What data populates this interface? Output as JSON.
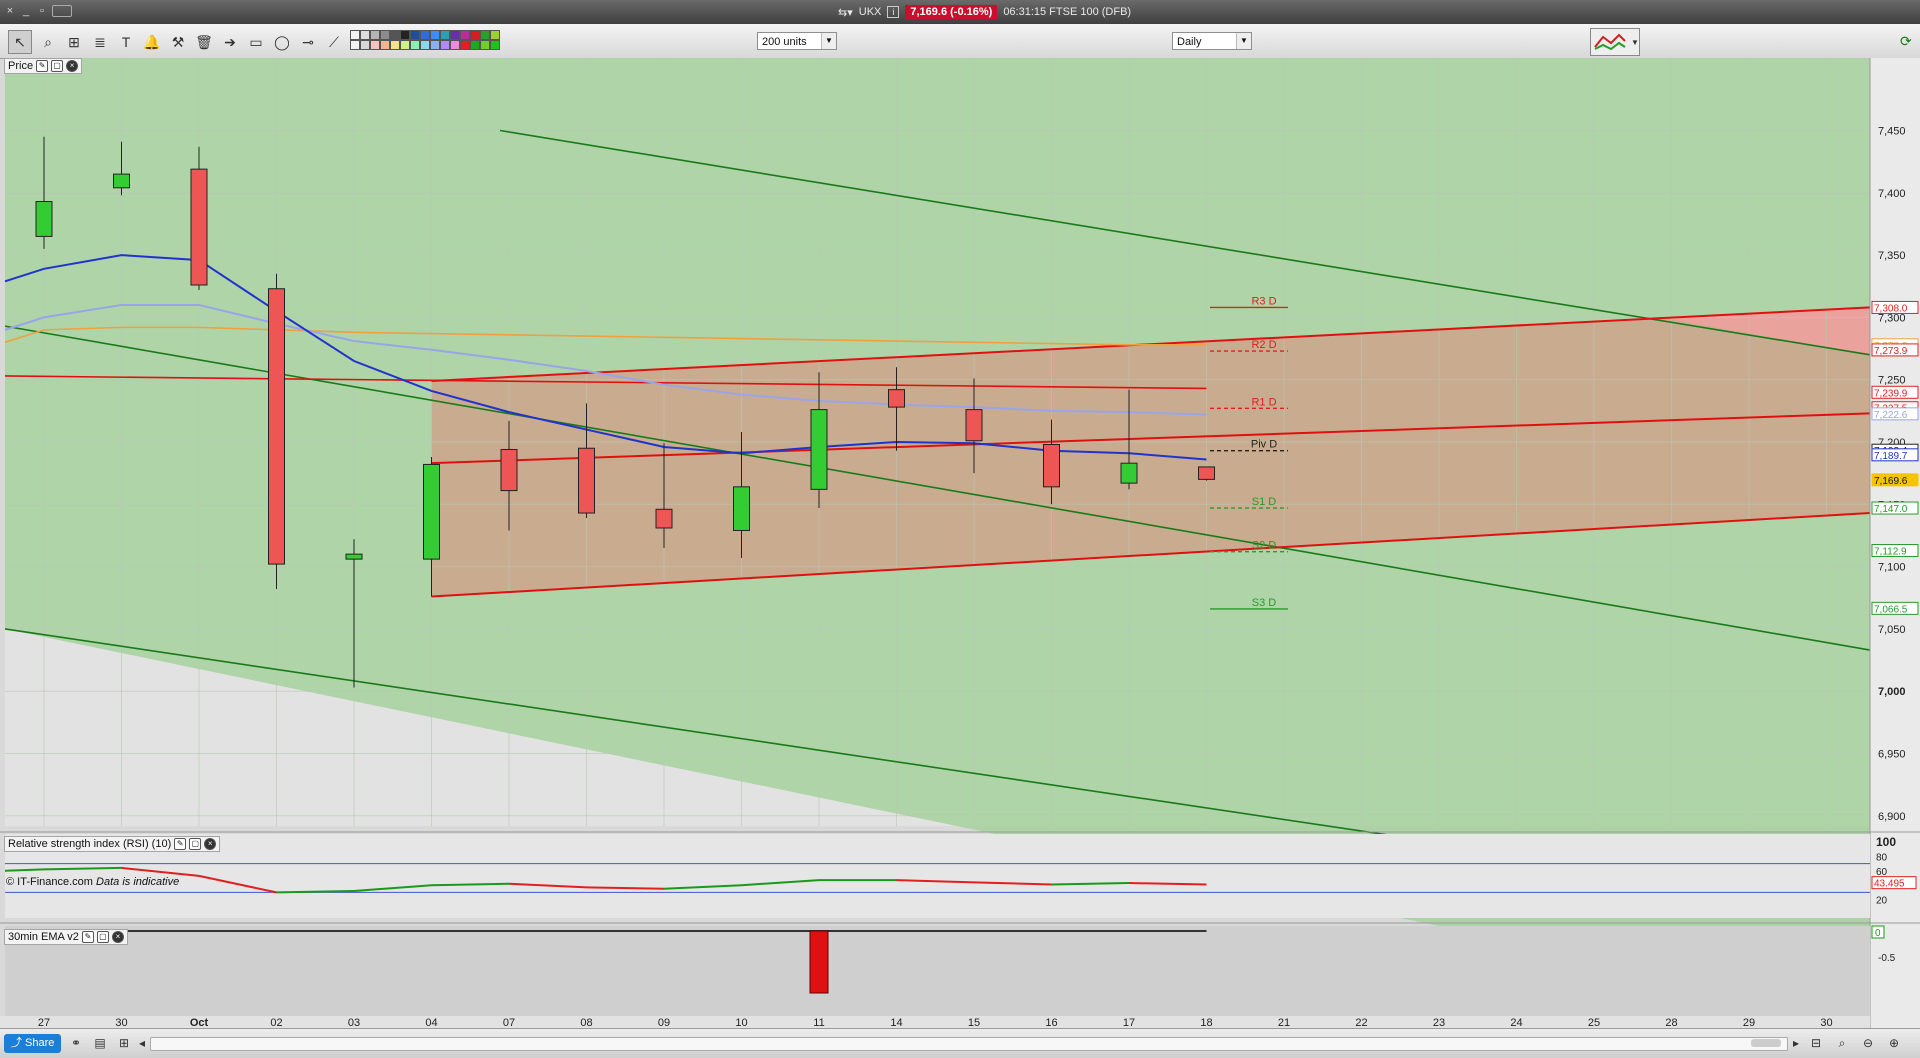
{
  "window": {
    "instrument": "UKX",
    "price_badge": "7,169.6 (-0.16%)",
    "time_name": "06:31:15 FTSE 100 (DFB)"
  },
  "toolbar": {
    "units_value": "200 units",
    "interval_value": "Daily",
    "swatch_colors": [
      "#f2f2f2",
      "#dcdcdc",
      "#b5b5b5",
      "#8c8c8c",
      "#555555",
      "#222222",
      "#1f4e9e",
      "#2d6fd6",
      "#3b8cff",
      "#2aa0b0",
      "#6a2db0",
      "#c02a9a",
      "#d21e1e",
      "#2aa02a",
      "#a0d02a",
      "#f2f2f2",
      "#d8d8d8",
      "#f6c1c1",
      "#f7b48a",
      "#f5e08a",
      "#d0f08a",
      "#8af0b4",
      "#8ad8f0",
      "#8ab0f0",
      "#b48af0",
      "#f08ad8",
      "#e41f1f",
      "#1fa81f",
      "#6fcf30",
      "#20c020"
    ]
  },
  "price_panel": {
    "label": "Price",
    "credit": "© IT-Finance.com",
    "credit_note": "Data is indicative"
  },
  "rsi_panel": {
    "label": "Relative strength index (RSI) (10)",
    "current_value": "43.495",
    "axis_labels": [
      "100",
      "80",
      "60",
      "20"
    ]
  },
  "ema_panel": {
    "label": "30min EMA v2",
    "axis_labels": [
      "0",
      "-0.5"
    ]
  },
  "chart_data": {
    "type": "candlestick",
    "x_labels": [
      "27",
      "30",
      "Oct",
      "02",
      "03",
      "04",
      "07",
      "08",
      "09",
      "10",
      "11",
      "14",
      "15",
      "16",
      "17",
      "18",
      "21",
      "22",
      "23",
      "24",
      "25",
      "28",
      "29",
      "30"
    ],
    "y_ticks": [
      "7,450",
      "7,400",
      "7,350",
      "7,300",
      "7,250",
      "7,200",
      "7,150",
      "7,100",
      "7,050",
      "7,000",
      "6,950",
      "6,900"
    ],
    "ylim": [
      6870,
      7470
    ],
    "candles": [
      {
        "label": "27",
        "open": 7365,
        "high": 7445,
        "low": 7355,
        "close": 7393
      },
      {
        "label": "30",
        "open": 7404,
        "high": 7441,
        "low": 7398,
        "close": 7415
      },
      {
        "label": "Oct",
        "open": 7419,
        "high": 7437,
        "low": 7322,
        "close": 7326
      },
      {
        "label": "02",
        "open": 7323,
        "high": 7335,
        "low": 7082,
        "close": 7102
      },
      {
        "label": "03",
        "open": 7106,
        "high": 7122,
        "low": 7003,
        "close": 7110
      },
      {
        "label": "04",
        "open": 7106,
        "high": 7188,
        "low": 7076,
        "close": 7182
      },
      {
        "label": "07",
        "open": 7194,
        "high": 7217,
        "low": 7129,
        "close": 7161
      },
      {
        "label": "08",
        "open": 7195,
        "high": 7231,
        "low": 7139,
        "close": 7143
      },
      {
        "label": "09",
        "open": 7146,
        "high": 7199,
        "low": 7115,
        "close": 7131
      },
      {
        "label": "10",
        "open": 7129,
        "high": 7208,
        "low": 7107,
        "close": 7164
      },
      {
        "label": "11",
        "open": 7162,
        "high": 7256,
        "low": 7147,
        "close": 7226
      },
      {
        "label": "14",
        "open": 7242,
        "high": 7260,
        "low": 7193,
        "close": 7228
      },
      {
        "label": "15",
        "open": 7226,
        "high": 7251,
        "low": 7175,
        "close": 7201
      },
      {
        "label": "16",
        "open": 7198,
        "high": 7218,
        "low": 7150,
        "close": 7164
      },
      {
        "label": "17",
        "open": 7167,
        "high": 7242,
        "low": 7162,
        "close": 7183
      },
      {
        "label": "18",
        "open": 7180,
        "high": 7180,
        "low": 7169,
        "close": 7170
      }
    ],
    "right_labels": [
      {
        "value": 7308.0,
        "text": "7,308.0",
        "color": "#e02020"
      },
      {
        "value": 7278.0,
        "text": "7,278.0",
        "color": "#f0a040"
      },
      {
        "value": 7273.9,
        "text": "7,273.9",
        "color": "#e02020"
      },
      {
        "value": 7239.9,
        "text": "7,239.9",
        "color": "#e02020"
      },
      {
        "value": 7227.5,
        "text": "7,227.5",
        "color": "#e02020"
      },
      {
        "value": 7222.6,
        "text": "7,222.6",
        "color": "#9aa4e8"
      },
      {
        "value": 7193.4,
        "text": "7,193.4",
        "color": "#222222"
      },
      {
        "value": 7189.7,
        "text": "7,189.7",
        "color": "#2233cc"
      },
      {
        "value": 7169.6,
        "text": "7,169.6",
        "color": "#f5c400"
      },
      {
        "value": 7147.0,
        "text": "7,147.0",
        "color": "#2a9a2a"
      },
      {
        "value": 7112.9,
        "text": "7,112.9",
        "color": "#2a9a2a"
      },
      {
        "value": 7066.5,
        "text": "7,066.5",
        "color": "#2a9a2a"
      }
    ],
    "pivots": [
      {
        "name": "R3 D",
        "value": 7308,
        "color": "#e02020",
        "dashed": false
      },
      {
        "name": "R2 D",
        "value": 7273,
        "color": "#e02020",
        "dashed": true
      },
      {
        "name": "R1 D",
        "value": 7227,
        "color": "#e02020",
        "dashed": true
      },
      {
        "name": "Piv D",
        "value": 7193,
        "color": "#222222",
        "dashed": true
      },
      {
        "name": "S1 D",
        "value": 7147,
        "color": "#2a9a2a",
        "dashed": true
      },
      {
        "name": "S2 D",
        "value": 7112,
        "color": "#2a9a2a",
        "dashed": true
      },
      {
        "name": "S3 D",
        "value": 7066,
        "color": "#2a9a2a",
        "dashed": false
      }
    ],
    "ma_fast": [
      7339,
      7350,
      7346,
      7305,
      7265,
      7241,
      7224,
      7210,
      7196,
      7191,
      7196,
      7200,
      7199,
      7193,
      7191,
      7186
    ],
    "ma_mid": [
      7300,
      7310,
      7310,
      7295,
      7281,
      7274,
      7266,
      7257,
      7246,
      7238,
      7233,
      7230,
      7228,
      7225,
      7224,
      7222
    ],
    "ma_slow": [
      7290,
      7292,
      7292,
      7290,
      7288,
      7287,
      7286,
      7285,
      7284,
      7283,
      7282,
      7281,
      7280,
      7279,
      7278,
      7278
    ],
    "rsi": [
      62,
      64,
      53,
      30,
      32,
      40,
      42,
      37,
      35,
      40,
      47,
      47,
      44,
      41,
      43,
      41
    ],
    "rsi_levels": [
      70,
      30
    ],
    "ema_bar": {
      "label": "11",
      "value": -0.62
    }
  }
}
